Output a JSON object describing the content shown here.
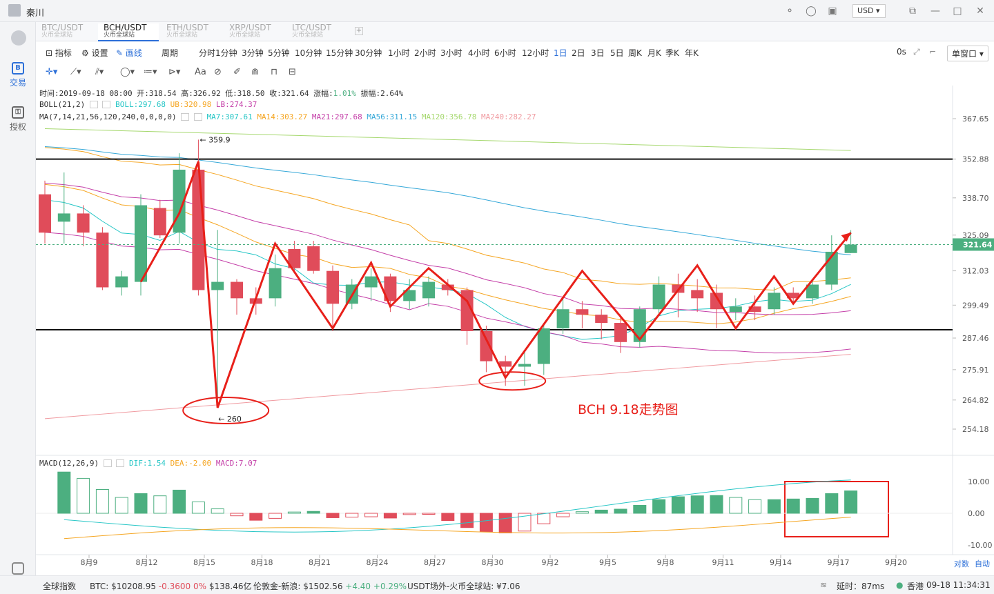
{
  "titlebar": {
    "user": "秦川",
    "currency": "USD"
  },
  "sidebar": {
    "trade": "交易",
    "auth": "授权"
  },
  "tabs": [
    {
      "name": "BTC/USDT",
      "sub": "火币全球站"
    },
    {
      "name": "BCH/USDT",
      "sub": "火币全球站"
    },
    {
      "name": "ETH/USDT",
      "sub": "火币全球站"
    },
    {
      "name": "XRP/USDT",
      "sub": "火币全球站"
    },
    {
      "name": "LTC/USDT",
      "sub": "火币全球站"
    }
  ],
  "toolbar": {
    "indicator": "指标",
    "settings": "设置",
    "draw": "画线",
    "period": "周期",
    "periods": [
      "分时",
      "1分钟",
      "3分钟",
      "5分钟",
      "10分钟",
      "15分钟",
      "30分钟",
      "1小时",
      "2小时",
      "3小时",
      "4小时",
      "6小时",
      "12小时",
      "1日",
      "2日",
      "3日",
      "5日",
      "周K",
      "月K",
      "季K",
      "年K"
    ],
    "active_period": "1日",
    "seconds": "0s",
    "window_mode": "单窗口",
    "tools_text": "Aa"
  },
  "info": {
    "ohlc": {
      "time": "时间:2019-09-18 08:00",
      "open": "开:318.54",
      "high": "高:326.92",
      "low": "低:318.50",
      "close": "收:321.64",
      "change_label": "涨幅:",
      "change": "1.01%",
      "amp": "振幅:2.64%"
    },
    "boll": {
      "label": "BOLL(21,2)",
      "boll": "BOLL:297.68",
      "ub": "UB:320.98",
      "lb": "LB:274.37"
    },
    "ma": {
      "label": "MA(7,14,21,56,120,240,0,0,0,0)",
      "ma7": "MA7:307.61",
      "ma14": "MA14:303.27",
      "ma21": "MA21:297.68",
      "ma56": "MA56:311.15",
      "ma120": "MA120:356.78",
      "ma240": "MA240:282.27"
    },
    "macd": {
      "label": "MACD(12,26,9)",
      "dif": "DIF:1.54",
      "dea": "DEA:-2.00",
      "macd": "MACD:7.07"
    }
  },
  "annotations": {
    "title": "BCH  9.18走势图",
    "high": "359.9",
    "low": "260"
  },
  "axes": {
    "bottom_right": [
      "对数",
      "自动"
    ],
    "current_price": "321.64"
  },
  "colors": {
    "up": "#4caf80",
    "down": "#e04c5a",
    "ma7": "#26c6c6",
    "ma14": "#f5a623",
    "ma21": "#c43fa8",
    "ma56": "#35a8d8",
    "ma120": "#a6d86f",
    "ma240": "#f09aa0",
    "arrow": "#e8201a"
  },
  "footer": {
    "index": "全球指数",
    "btc_label": "BTC:",
    "btc_price": "$10208.95",
    "btc_change": "-0.3600",
    "btc_pct": "0%",
    "btc_vol": "$138.46亿",
    "gold_label": "伦敦金-新浪:",
    "gold_price": "$1502.56",
    "gold_change": "+4.40",
    "gold_pct": "+0.29%",
    "usdt": "USDT场外-火币全球站: ¥7.06",
    "latency": "延时：87ms",
    "region": "香港",
    "datetime": "09-18 11:34:31"
  },
  "chart_data": {
    "type": "candlestick",
    "x_labels": [
      "8月9",
      "8月12",
      "8月15",
      "8月18",
      "8月21",
      "8月24",
      "8月27",
      "8月30",
      "9月2",
      "9月5",
      "9月8",
      "9月11",
      "9月14",
      "9月17",
      "9月20"
    ],
    "y_ticks": [
      367.65,
      352.88,
      338.7,
      325.09,
      312.03,
      299.49,
      287.46,
      275.91,
      264.82,
      254.18
    ],
    "macd_ticks": [
      10.0,
      0.0,
      -10.0
    ],
    "candles": [
      {
        "date": "08-07",
        "o": 340,
        "h": 345,
        "l": 322,
        "c": 326
      },
      {
        "date": "08-08",
        "o": 330,
        "h": 348,
        "l": 322,
        "c": 333
      },
      {
        "date": "08-09",
        "o": 333,
        "h": 336,
        "l": 321,
        "c": 326
      },
      {
        "date": "08-10",
        "o": 326,
        "h": 328,
        "l": 305,
        "c": 306
      },
      {
        "date": "08-11",
        "o": 306,
        "h": 312,
        "l": 303,
        "c": 310
      },
      {
        "date": "08-12",
        "o": 308,
        "h": 340,
        "l": 303,
        "c": 336
      },
      {
        "date": "08-13",
        "o": 335,
        "h": 338,
        "l": 324,
        "c": 325
      },
      {
        "date": "08-14",
        "o": 326,
        "h": 355,
        "l": 322,
        "c": 349
      },
      {
        "date": "08-15",
        "o": 349,
        "h": 360,
        "l": 303,
        "c": 305
      },
      {
        "date": "08-16",
        "o": 305,
        "h": 327,
        "l": 262,
        "c": 308
      },
      {
        "date": "08-17",
        "o": 308,
        "h": 309,
        "l": 296,
        "c": 302
      },
      {
        "date": "08-18",
        "o": 302,
        "h": 306,
        "l": 296,
        "c": 300
      },
      {
        "date": "08-19",
        "o": 302,
        "h": 318,
        "l": 299,
        "c": 313
      },
      {
        "date": "08-20",
        "o": 320,
        "h": 323,
        "l": 312,
        "c": 313
      },
      {
        "date": "08-21",
        "o": 321,
        "h": 323,
        "l": 311,
        "c": 312
      },
      {
        "date": "08-22",
        "o": 312,
        "h": 314,
        "l": 290,
        "c": 300
      },
      {
        "date": "08-23",
        "o": 300,
        "h": 309,
        "l": 298,
        "c": 307
      },
      {
        "date": "08-24",
        "o": 306,
        "h": 313,
        "l": 301,
        "c": 310
      },
      {
        "date": "08-25",
        "o": 310,
        "h": 311,
        "l": 297,
        "c": 301
      },
      {
        "date": "08-26",
        "o": 301,
        "h": 309,
        "l": 298,
        "c": 305
      },
      {
        "date": "08-27",
        "o": 302,
        "h": 310,
        "l": 299,
        "c": 308
      },
      {
        "date": "08-28",
        "o": 307,
        "h": 309,
        "l": 303,
        "c": 305
      },
      {
        "date": "08-29",
        "o": 305,
        "h": 306,
        "l": 285,
        "c": 290
      },
      {
        "date": "08-30",
        "o": 290,
        "h": 292,
        "l": 275,
        "c": 279
      },
      {
        "date": "08-31",
        "o": 279,
        "h": 281,
        "l": 270,
        "c": 277
      },
      {
        "date": "09-01",
        "o": 277,
        "h": 283,
        "l": 270,
        "c": 278
      },
      {
        "date": "09-02",
        "o": 278,
        "h": 292,
        "l": 274,
        "c": 291
      },
      {
        "date": "09-03",
        "o": 291,
        "h": 302,
        "l": 289,
        "c": 298
      },
      {
        "date": "09-04",
        "o": 298,
        "h": 301,
        "l": 291,
        "c": 296
      },
      {
        "date": "09-05",
        "o": 296,
        "h": 298,
        "l": 287,
        "c": 293
      },
      {
        "date": "09-06",
        "o": 293,
        "h": 296,
        "l": 282,
        "c": 286
      },
      {
        "date": "09-07",
        "o": 286,
        "h": 299,
        "l": 284,
        "c": 298
      },
      {
        "date": "09-08",
        "o": 298,
        "h": 310,
        "l": 296,
        "c": 307
      },
      {
        "date": "09-09",
        "o": 307,
        "h": 311,
        "l": 295,
        "c": 304
      },
      {
        "date": "09-10",
        "o": 305,
        "h": 309,
        "l": 297,
        "c": 302
      },
      {
        "date": "09-11",
        "o": 304,
        "h": 307,
        "l": 291,
        "c": 298
      },
      {
        "date": "09-12",
        "o": 297,
        "h": 302,
        "l": 294,
        "c": 299
      },
      {
        "date": "09-13",
        "o": 299,
        "h": 303,
        "l": 294,
        "c": 297
      },
      {
        "date": "09-14",
        "o": 298,
        "h": 306,
        "l": 296,
        "c": 304
      },
      {
        "date": "09-15",
        "o": 304,
        "h": 306,
        "l": 300,
        "c": 302
      },
      {
        "date": "09-16",
        "o": 302,
        "h": 309,
        "l": 300,
        "c": 307
      },
      {
        "date": "09-17",
        "o": 307,
        "h": 325,
        "l": 305,
        "c": 319
      },
      {
        "date": "09-18",
        "o": 318.54,
        "h": 326.92,
        "l": 318.5,
        "c": 321.64
      }
    ],
    "macd_hist": [
      13,
      11,
      7.5,
      5,
      6.2,
      5.5,
      7.3,
      3.6,
      1.4,
      -0.8,
      -2.2,
      -1.6,
      0.4,
      0.6,
      -1.4,
      -1.2,
      -1.1,
      -1.5,
      -0.4,
      -0.2,
      -2.3,
      -4.5,
      -5.8,
      -6.2,
      -5.6,
      -3.3,
      -1.1,
      0.5,
      1.0,
      1.3,
      2.5,
      4.3,
      5.2,
      5.5,
      5.6,
      5.0,
      4.3,
      4.3,
      4.5,
      4.7,
      6.2,
      7.07
    ],
    "resistance": 352.88,
    "support": 290.5
  }
}
